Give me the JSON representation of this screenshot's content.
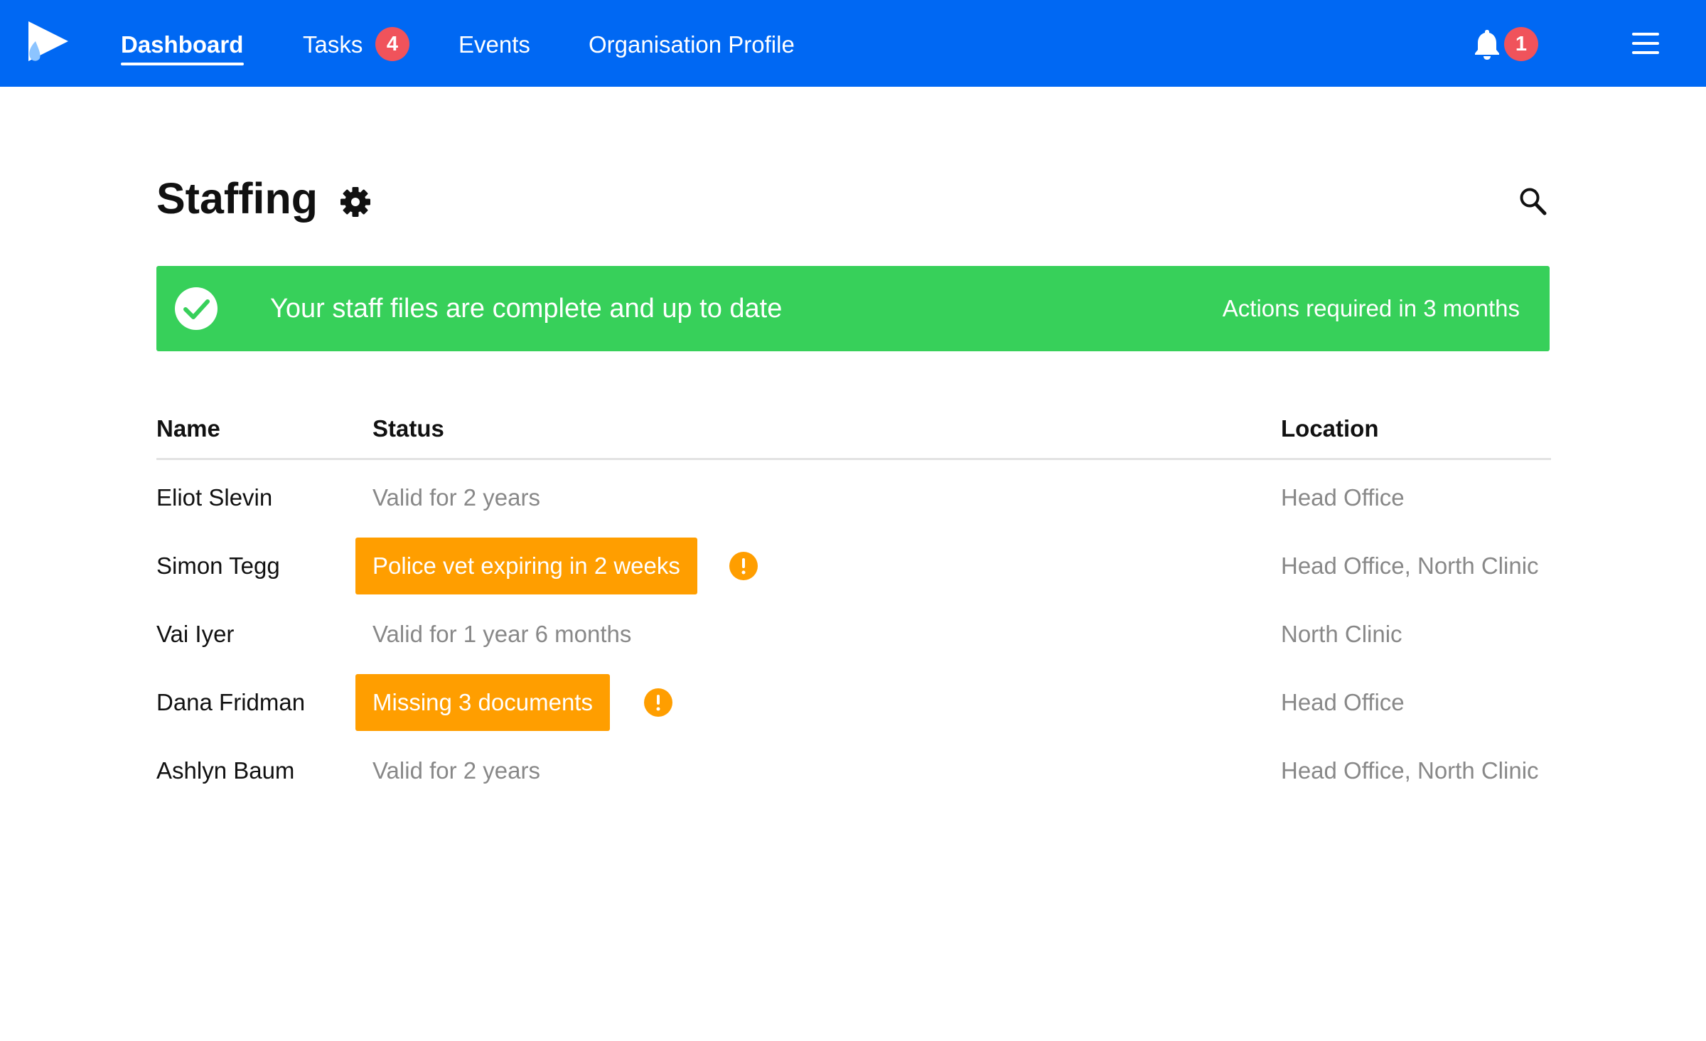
{
  "nav": {
    "items": [
      {
        "label": "Dashboard",
        "active": true
      },
      {
        "label": "Tasks",
        "badge": "4"
      },
      {
        "label": "Events"
      },
      {
        "label": "Organisation Profile"
      }
    ],
    "notifications_badge": "1",
    "icons": {
      "logo": "play-logo",
      "bell": "bell-icon",
      "menu": "hamburger-menu-icon"
    }
  },
  "page": {
    "title": "Staffing",
    "icons": {
      "settings": "gear-icon",
      "search": "search-icon"
    }
  },
  "banner": {
    "message": "Your staff files are complete and up to date",
    "action": "Actions required in 3 months",
    "icon": "check-circle-icon"
  },
  "table": {
    "columns": [
      "Name",
      "Status",
      "Location"
    ],
    "rows": [
      {
        "name": "Eliot Slevin",
        "status": "Valid for 2 years",
        "location": "Head Office",
        "alert": false
      },
      {
        "name": "Simon Tegg",
        "status": "Police vet expiring in 2 weeks",
        "location": "Head Office, North Clinic",
        "alert": true
      },
      {
        "name": "Vai Iyer",
        "status": "Valid for 1 year 6 months",
        "location": "North Clinic",
        "alert": false
      },
      {
        "name": "Dana Fridman",
        "status": "Missing 3 documents",
        "location": "Head Office",
        "alert": true
      },
      {
        "name": "Ashlyn Baum",
        "status": "Valid for 2 years",
        "location": "Head Office, North Clinic",
        "alert": false
      }
    ]
  },
  "colors": {
    "nav_background": "#0068F3",
    "badge": "#F0535B",
    "banner_success": "#37D05A",
    "warning": "#FF9E00",
    "muted_text": "#888888"
  }
}
